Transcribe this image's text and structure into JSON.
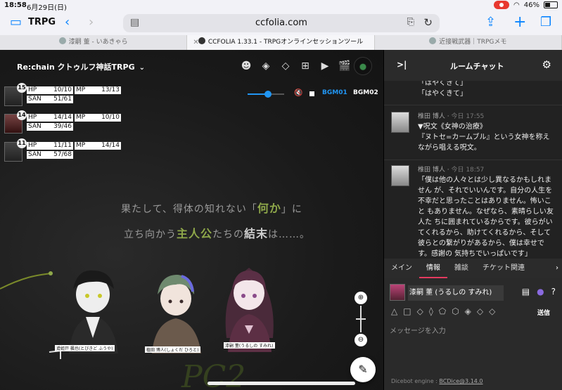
{
  "status": {
    "time": "18:58",
    "date": "6月29日(日)",
    "battery": "46%",
    "battery_level": 0.46
  },
  "browser": {
    "sidebar_title": "TRPG",
    "url": "ccfolia.com",
    "tabs": [
      {
        "label": "漆嗣 董 - いあきゃら",
        "active": false
      },
      {
        "label": "CCFOLIA 1.33.1 - TRPGオンラインセッションツール",
        "active": true
      },
      {
        "label": "近接戦武器｜TRPGメモ",
        "active": false
      }
    ]
  },
  "room": {
    "title": "Re:chain クトゥルフ神話TRPG",
    "audio": {
      "volume": 0.55,
      "bgm1": "BGM01",
      "bgm2": "BGM02"
    }
  },
  "characters": [
    {
      "initiative": "15",
      "hp_label": "HP",
      "hp": "10/10",
      "mp_label": "MP",
      "mp": "13/13",
      "san_label": "SAN",
      "san": "51/61"
    },
    {
      "initiative": "14",
      "hp_label": "HP",
      "hp": "14/14",
      "mp_label": "MP",
      "mp": "10/10",
      "san_label": "SAN",
      "san": "39/46"
    },
    {
      "initiative": "11",
      "hp_label": "HP",
      "hp": "11/11",
      "mp_label": "MP",
      "mp": "14/14",
      "san_label": "SAN",
      "san": "57/68"
    }
  ],
  "narration": {
    "line1_a": "果たして、得体の知れない「",
    "line1_hl": "何か",
    "line1_b": "」に",
    "line2_a": "立ち向かう",
    "line2_hl": "主人公",
    "line2_b": "たちの",
    "line2_bold": "結末",
    "line2_c": "は……。"
  },
  "figure_captions": [
    "鳶姫戸 楓也(とびきど ふうや)",
    "植田 博人(しょくだ ひろと)",
    "漆嗣 董(うるしの すみれ)"
  ],
  "stage_deco": "PC2",
  "chat": {
    "title": "ルームチャット",
    "messages": [
      {
        "name": "",
        "time": "",
        "text": "「はやくきて」\n「はやくきて」"
      },
      {
        "name": "椎田 博人",
        "time": "今日 17:55",
        "text": "▼呪文《女神の治療》\n『ヌトセ=カームブル』という女神を称えながら唱える呪文。"
      },
      {
        "name": "椎田 博人",
        "time": "今日 18:57",
        "text": "「僕は他の人々とは少し異なるかもしれません が、それでいいんです。自分の人生を不幸だと思ったことはありません。怖いこと もありません。なぜなら、素晴らしい友人た ちに囲まれているからです。彼らがいてくれるから、助けてくれるから、そして彼らとの繋がりがあるから、僕は幸せです。感謝の 気持ちでいっぱいです」"
      }
    ],
    "tabs": [
      "メイン",
      "情報",
      "雑談",
      "チケット関連"
    ],
    "active_tab": "情報",
    "speaker": "漆嗣 董 (うるしの すみれ)",
    "send_label": "送信",
    "input_placeholder": "メッセージを入力",
    "footer_prefix": "Dicebot engine : ",
    "footer_link": "BCDice@3.14.0"
  },
  "colors": {
    "accent": "#2196f3",
    "tab_underline": "#e53a5f",
    "highlight": "#8fa84a"
  }
}
